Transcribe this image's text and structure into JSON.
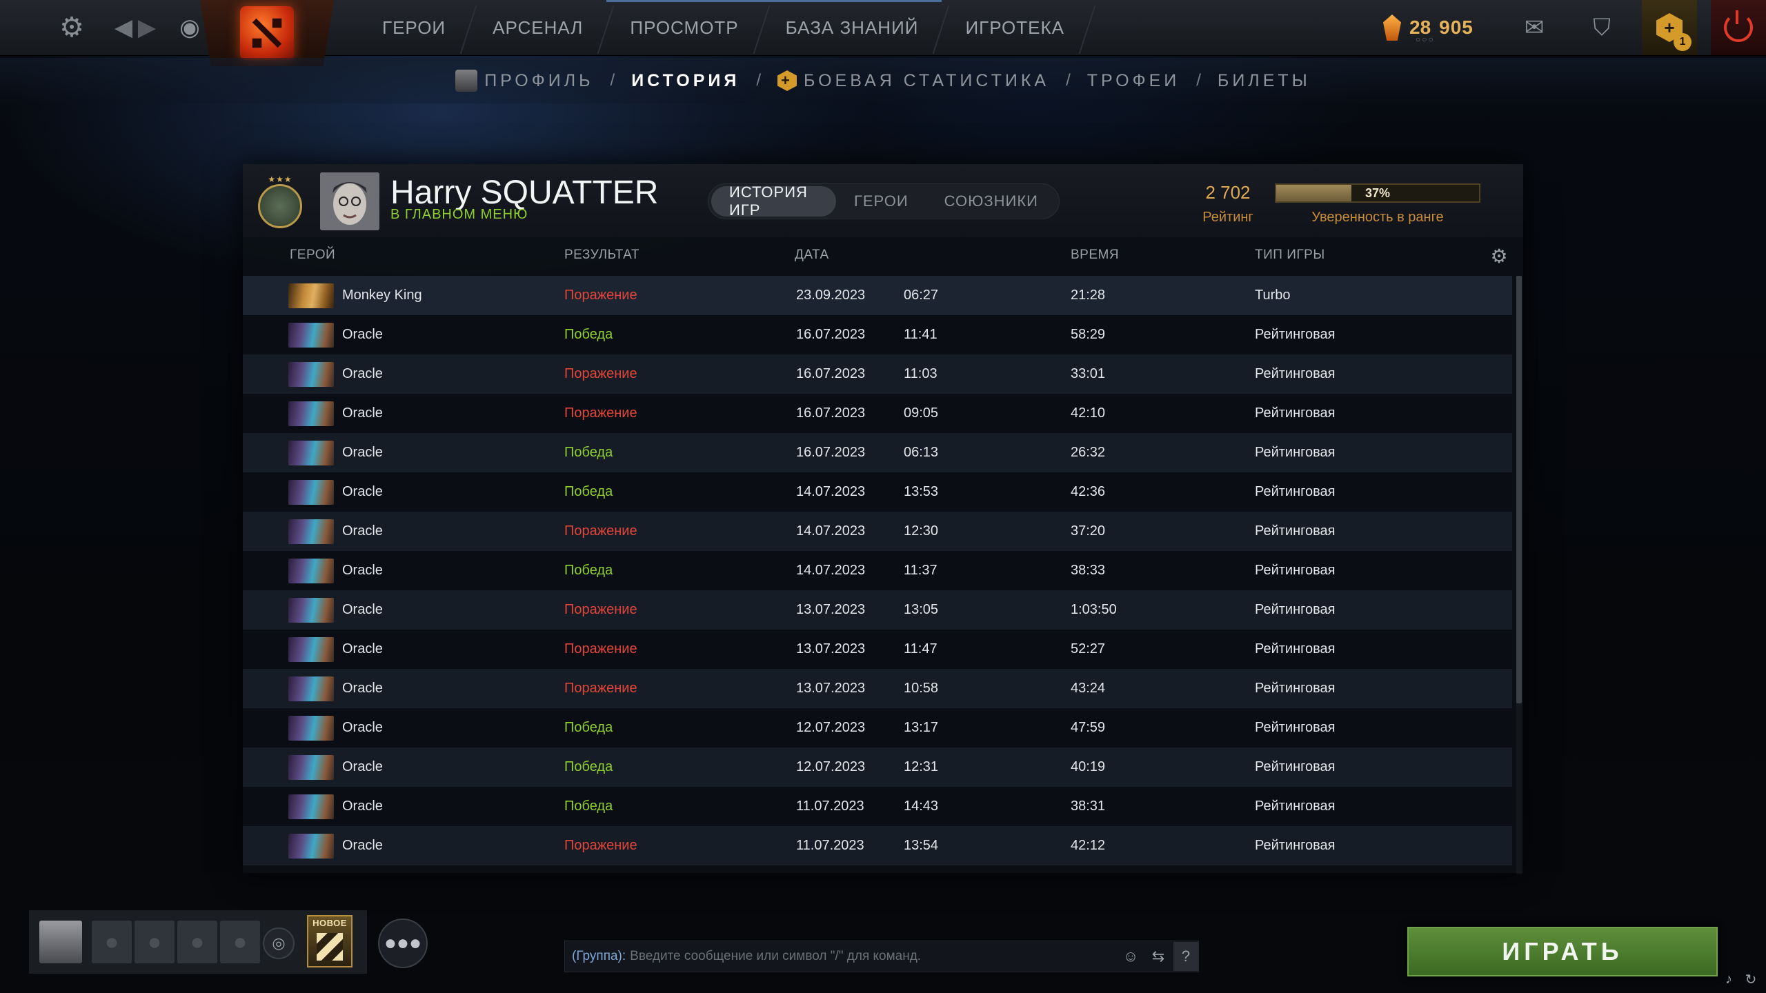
{
  "topbar": {
    "nav": [
      "ГЕРОИ",
      "АРСЕНАЛ",
      "ПРОСМОТР",
      "БАЗА ЗНАНИЙ",
      "ИГРОТЕКА"
    ],
    "currency_level": "28",
    "currency_amount": "905",
    "plus_badge": "1",
    "icons": {
      "settings": "gear-icon",
      "back": "arrow-left-icon",
      "forward": "arrow-right-icon",
      "watch": "eye-icon",
      "mail": "mail-icon",
      "armory": "armory-icon",
      "plus": "dota-plus-icon",
      "power": "power-icon"
    }
  },
  "subnav": {
    "profile": "ПРОФИЛЬ",
    "history": "ИСТОРИЯ",
    "battle_stats": "БОЕВАЯ СТАТИСТИКА",
    "trophies": "ТРОФЕИ",
    "tickets": "БИЛЕТЫ",
    "separator": "/"
  },
  "profile": {
    "name": "Harry SQUATTER",
    "status": "В ГЛАВНОМ МЕНЮ",
    "rating_value": "2 702",
    "rating_label": "Рейтинг",
    "confidence_percent": 37,
    "confidence_text": "37%",
    "confidence_label": "Уверенность в ранге"
  },
  "tabs": [
    "ИСТОРИЯ ИГР",
    "ГЕРОИ",
    "СОЮЗНИКИ"
  ],
  "table": {
    "headers": {
      "hero": "ГЕРОЙ",
      "result": "РЕЗУЛЬТАТ",
      "date": "ДАТА",
      "duration": "ВРЕМЯ",
      "mode": "ТИП ИГРЫ"
    },
    "rows": [
      {
        "hero": "Monkey King",
        "result": "Поражение",
        "date": "23.09.2023",
        "time": "06:27",
        "duration": "21:28",
        "mode": "Turbo"
      },
      {
        "hero": "Oracle",
        "result": "Победа",
        "date": "16.07.2023",
        "time": "11:41",
        "duration": "58:29",
        "mode": "Рейтинговая"
      },
      {
        "hero": "Oracle",
        "result": "Поражение",
        "date": "16.07.2023",
        "time": "11:03",
        "duration": "33:01",
        "mode": "Рейтинговая"
      },
      {
        "hero": "Oracle",
        "result": "Поражение",
        "date": "16.07.2023",
        "time": "09:05",
        "duration": "42:10",
        "mode": "Рейтинговая"
      },
      {
        "hero": "Oracle",
        "result": "Победа",
        "date": "16.07.2023",
        "time": "06:13",
        "duration": "26:32",
        "mode": "Рейтинговая"
      },
      {
        "hero": "Oracle",
        "result": "Победа",
        "date": "14.07.2023",
        "time": "13:53",
        "duration": "42:36",
        "mode": "Рейтинговая"
      },
      {
        "hero": "Oracle",
        "result": "Поражение",
        "date": "14.07.2023",
        "time": "12:30",
        "duration": "37:20",
        "mode": "Рейтинговая"
      },
      {
        "hero": "Oracle",
        "result": "Победа",
        "date": "14.07.2023",
        "time": "11:37",
        "duration": "38:33",
        "mode": "Рейтинговая"
      },
      {
        "hero": "Oracle",
        "result": "Поражение",
        "date": "13.07.2023",
        "time": "13:05",
        "duration": "1:03:50",
        "mode": "Рейтинговая"
      },
      {
        "hero": "Oracle",
        "result": "Поражение",
        "date": "13.07.2023",
        "time": "11:47",
        "duration": "52:27",
        "mode": "Рейтинговая"
      },
      {
        "hero": "Oracle",
        "result": "Поражение",
        "date": "13.07.2023",
        "time": "10:58",
        "duration": "43:24",
        "mode": "Рейтинговая"
      },
      {
        "hero": "Oracle",
        "result": "Победа",
        "date": "12.07.2023",
        "time": "13:17",
        "duration": "47:59",
        "mode": "Рейтинговая"
      },
      {
        "hero": "Oracle",
        "result": "Победа",
        "date": "12.07.2023",
        "time": "12:31",
        "duration": "40:19",
        "mode": "Рейтинговая"
      },
      {
        "hero": "Oracle",
        "result": "Победа",
        "date": "11.07.2023",
        "time": "14:43",
        "duration": "38:31",
        "mode": "Рейтинговая"
      },
      {
        "hero": "Oracle",
        "result": "Поражение",
        "date": "11.07.2023",
        "time": "13:54",
        "duration": "42:12",
        "mode": "Рейтинговая"
      }
    ]
  },
  "bottom": {
    "new_badge": "НОВОЕ",
    "chat_prefix": "(Группа):",
    "chat_placeholder": "Введите сообщение или символ \"/\" для команд.",
    "chat_help": "?",
    "play": "ИГРАТЬ"
  },
  "colors": {
    "win": "#8fcf2f",
    "loss": "#e2463a",
    "gold": "#e0a950",
    "play_green": "#4f7f30"
  }
}
